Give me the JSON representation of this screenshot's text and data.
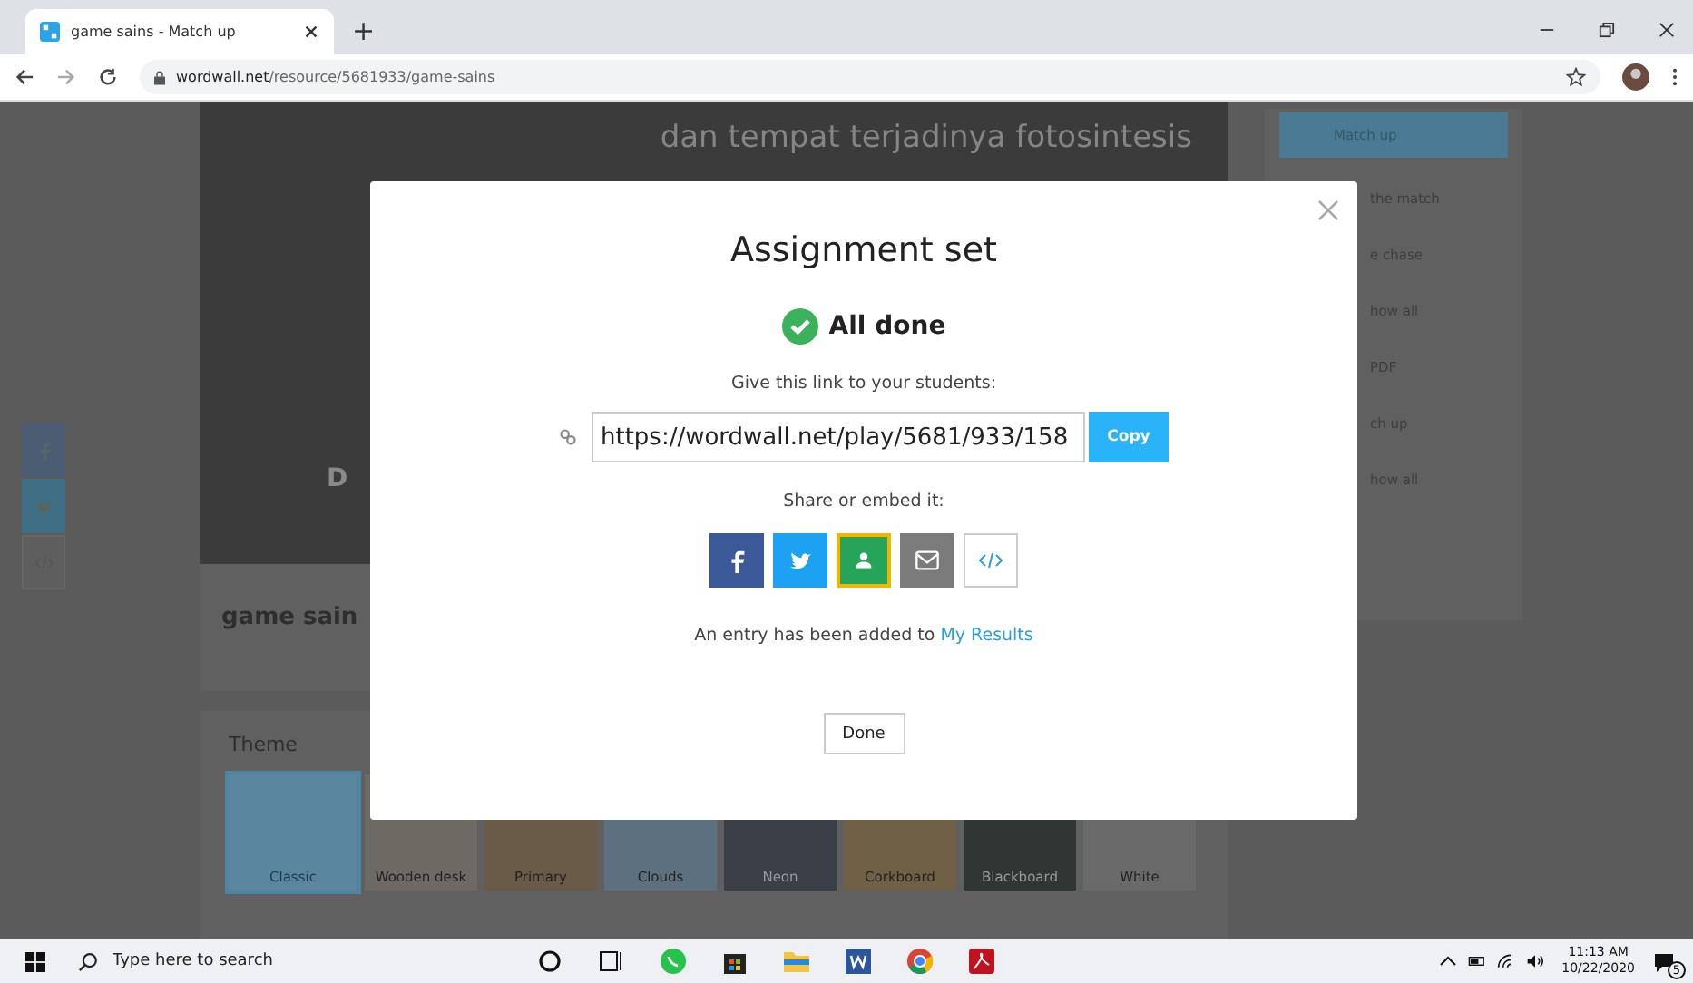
{
  "browser": {
    "tab_title": "game sains - Match up",
    "new_tab": "+",
    "url_domain": "wordwall.net",
    "url_path": "/resource/5681933/game-sains"
  },
  "page": {
    "subheading": "dan tempat terjadinya fotosintesis",
    "center_letter": "D",
    "title": "game sain",
    "side_panel": [
      {
        "text": "Match up",
        "selected": true
      },
      {
        "text": "the match",
        "selected": false
      },
      {
        "text": "e chase",
        "selected": false
      },
      {
        "text": "how all",
        "selected": false
      },
      {
        "text": "PDF",
        "selected": false
      },
      {
        "text": "ch up",
        "selected": false
      },
      {
        "text": "how all",
        "selected": false
      }
    ],
    "theme": {
      "label": "Theme",
      "items": [
        {
          "name": "Classic",
          "selected": true,
          "color": "#5a86a0"
        },
        {
          "name": "Wooden desk",
          "selected": false,
          "color": "#6e6a63"
        },
        {
          "name": "Primary",
          "selected": false,
          "color": "#6a5a48"
        },
        {
          "name": "Clouds",
          "selected": false,
          "color": "#5d7080"
        },
        {
          "name": "Neon",
          "selected": false,
          "color": "#3a3f48"
        },
        {
          "name": "Corkboard",
          "selected": false,
          "color": "#6f6046"
        },
        {
          "name": "Blackboard",
          "selected": false,
          "color": "#303633"
        },
        {
          "name": "White",
          "selected": false,
          "color": "#6a6a6a"
        }
      ]
    }
  },
  "modal": {
    "title": "Assignment set",
    "status": "All done",
    "prompt": "Give this link to your students:",
    "link": "https://wordwall.net/play/5681/933/158",
    "copy": "Copy",
    "share_prompt": "Share or embed it:",
    "share": [
      {
        "kind": "facebook"
      },
      {
        "kind": "twitter"
      },
      {
        "kind": "classroom"
      },
      {
        "kind": "email"
      },
      {
        "kind": "embed"
      }
    ],
    "note": "An entry has been added to",
    "note_link": "My Results",
    "done": "Done"
  },
  "taskbar": {
    "search_placeholder": "Type here to search",
    "time": "11:13 AM",
    "date": "10/22/2020",
    "notifications": "5"
  }
}
